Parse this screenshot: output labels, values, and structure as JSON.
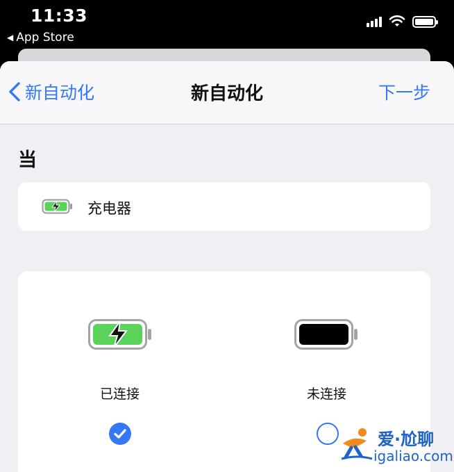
{
  "status_bar": {
    "time": "11:33",
    "back_app": "App Store",
    "back_icon": "triangle-left-icon",
    "signal_icon": "cellular-signal-icon",
    "wifi_icon": "wifi-icon",
    "battery_icon": "battery-icon"
  },
  "navbar": {
    "back_label": "新自动化",
    "title": "新自动化",
    "next_label": "下一步"
  },
  "section": {
    "label": "当"
  },
  "trigger": {
    "label": "充电器",
    "icon": "charging-battery-icon"
  },
  "options": [
    {
      "label": "已连接",
      "icon": "charging-battery-icon",
      "selected": true
    },
    {
      "label": "未连接",
      "icon": "battery-icon",
      "selected": false
    }
  ],
  "watermark": {
    "title": "爱·尬聊",
    "url": "igaliao.com"
  },
  "colors": {
    "accent": "#3478f6",
    "battery_green": "#5bd35b",
    "sheet_bg": "#efeff4"
  }
}
